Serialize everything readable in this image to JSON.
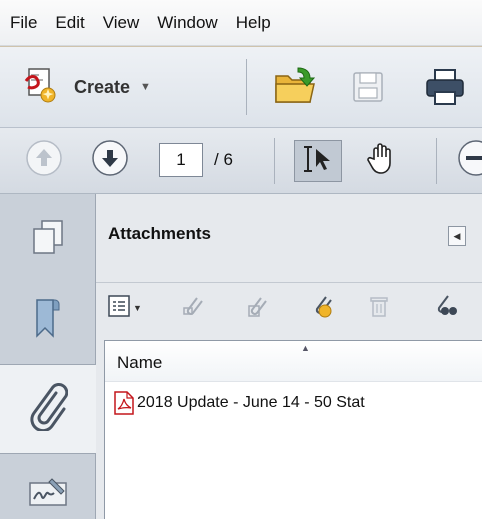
{
  "menubar": {
    "items": [
      "File",
      "Edit",
      "View",
      "Window",
      "Help"
    ]
  },
  "toolbar": {
    "create_label": "Create",
    "page_current": "1",
    "page_total": "/ 6"
  },
  "sidebar": {
    "items": [
      {
        "icon": "pages-icon"
      },
      {
        "icon": "bookmark-icon"
      },
      {
        "icon": "paperclip-icon",
        "active": true
      },
      {
        "icon": "signature-icon"
      }
    ]
  },
  "attachments_panel": {
    "title": "Attachments",
    "column_name": "Name",
    "rows": [
      {
        "icon": "pdf-icon",
        "name": "2018 Update - June 14 - 50 Stat"
      }
    ]
  },
  "colors": {
    "accent_pdf": "#c4161c",
    "folder": "#f0c24a",
    "green_arrow": "#3a9a2a"
  }
}
